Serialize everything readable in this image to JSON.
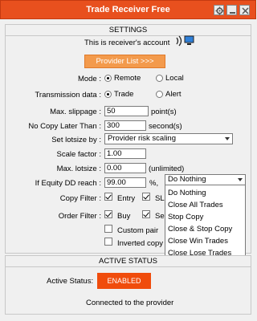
{
  "window": {
    "title": "Trade Receiver Free"
  },
  "settings": {
    "header": "SETTINGS",
    "receiver_text": "This is receiver's account",
    "provider_list_button": "Provider List >>>",
    "mode": {
      "label": "Mode :",
      "options": [
        "Remote",
        "Local"
      ],
      "selected": "Remote"
    },
    "transmission": {
      "label": "Transmission data :",
      "options": [
        "Trade",
        "Alert"
      ],
      "selected": "Trade"
    },
    "max_slippage": {
      "label": "Max. slippage :",
      "value": "50",
      "unit": "point(s)"
    },
    "no_copy_later": {
      "label": "No Copy Later Than :",
      "value": "300",
      "unit": "second(s)"
    },
    "lotsize": {
      "label": "Set lotsize by :",
      "value": "Provider risk scaling"
    },
    "scale_factor": {
      "label": "Scale factor :",
      "value": "1.00"
    },
    "max_lotsize": {
      "label": "Max. lotsize :",
      "value": "0.00",
      "unit": "(unlimited)"
    },
    "equity_dd": {
      "label": "If Equity DD reach :",
      "value": "99.00",
      "unit": "%,",
      "action": "Do Nothing"
    },
    "copy_filter": {
      "label": "Copy Filter :",
      "entry": "Entry",
      "sl": "SL"
    },
    "order_filter": {
      "label": "Order Filter :",
      "buy": "Buy",
      "sell": "Sel"
    },
    "custom_pair": "Custom pair",
    "inverted_copy": "Inverted copy"
  },
  "dropdown_options": [
    "Do Nothing",
    "Close All Trades",
    "Stop Copy",
    "Close & Stop Copy",
    "Close Win Trades",
    "Close Lose Trades"
  ],
  "status": {
    "header": "ACTIVE STATUS",
    "label": "Active Status:",
    "button": "ENABLED",
    "message": "Connected to the provider"
  }
}
